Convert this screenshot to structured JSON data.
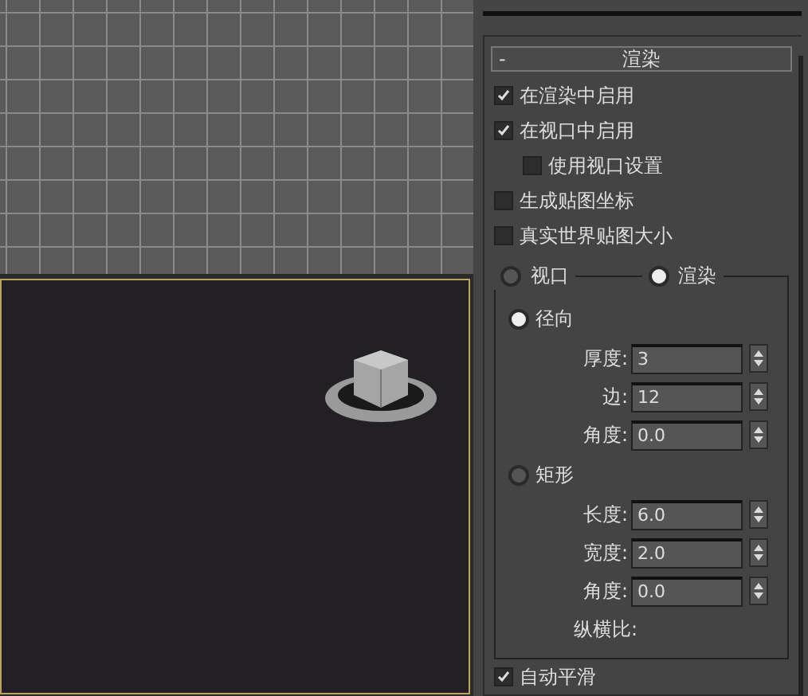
{
  "rollout": {
    "collapse": "-",
    "title": "渲染"
  },
  "options": [
    {
      "label": "在渲染中启用",
      "checked": true
    },
    {
      "label": "在视口中启用",
      "checked": true,
      "children": [
        {
          "label": "使用视口设置",
          "checked": false
        }
      ]
    },
    {
      "label": "生成贴图坐标",
      "checked": false
    },
    {
      "label": "真实世界贴图大小",
      "checked": false
    }
  ],
  "modes": [
    {
      "label": "视口",
      "selected": false
    },
    {
      "label": "渲染",
      "selected": true
    }
  ],
  "shapes": [
    {
      "label": "径向",
      "selected": true,
      "params": [
        {
          "label": "厚度:",
          "value": "3"
        },
        {
          "label": "边:",
          "value": "12"
        },
        {
          "label": "角度:",
          "value": "0.0"
        }
      ]
    },
    {
      "label": "矩形",
      "selected": false,
      "params": [
        {
          "label": "长度:",
          "value": "6.0"
        },
        {
          "label": "宽度:",
          "value": "2.0"
        },
        {
          "label": "角度:",
          "value": "0.0"
        },
        {
          "label": "纵横比:"
        }
      ]
    }
  ],
  "auto_smooth": {
    "label": "自动平滑",
    "checked": true
  }
}
